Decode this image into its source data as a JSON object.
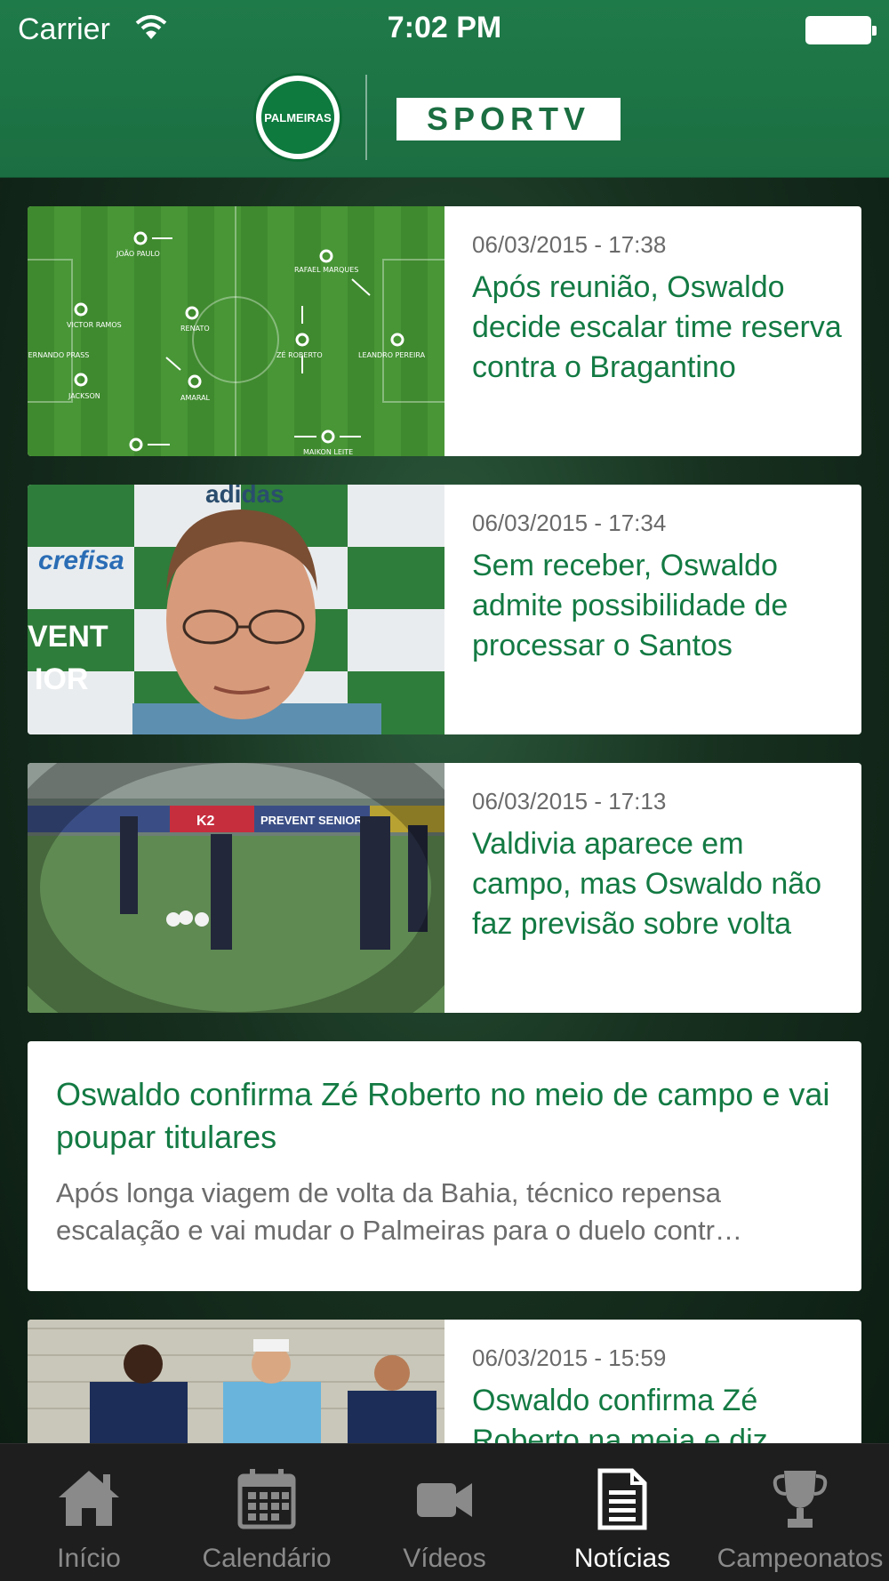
{
  "status_bar": {
    "carrier": "Carrier",
    "time": "7:02 PM"
  },
  "header": {
    "club_logo_text": "PALMEIRAS",
    "partner_logo_text": "SPORTV"
  },
  "news": [
    {
      "date": "06/03/2015 - 17:38",
      "title": "Após reunião, Oswaldo decide escalar time reserva contra o Bragantino",
      "formation_labels": [
        "JOÃO PAULO",
        "RAFAEL MARQUES",
        "VICTOR RAMOS",
        "RENATO",
        "ZÉ ROBERTO",
        "LEANDRO PEREIRA",
        "FERNANDO PRASS",
        "JACKSON",
        "AMARAL",
        "MAIKON LEITE"
      ]
    },
    {
      "date": "06/03/2015 - 17:34",
      "title": "Sem receber, Oswaldo admite possibilidade de processar o Santos",
      "backdrop_texts": [
        "adidas",
        "crefisa",
        "VENT",
        "IOR"
      ]
    },
    {
      "date": "06/03/2015 - 17:13",
      "title": "Valdivia aparece em campo, mas Oswaldo não faz previsão sobre volta",
      "banner_texts": [
        "K2",
        "PREVENT SENIOR"
      ]
    },
    {
      "title": "Oswaldo confirma Zé Roberto no meio de campo e vai poupar titulares",
      "summary": "Após longa viagem de volta da Bahia, técnico repensa escalação e vai mudar o Palmeiras para o duelo contr…"
    },
    {
      "date": "06/03/2015 - 15:59",
      "title": "Oswaldo confirma Zé Roberto na meia e diz"
    }
  ],
  "tabs": [
    {
      "label": "Início",
      "icon": "home-icon"
    },
    {
      "label": "Calendário",
      "icon": "calendar-icon"
    },
    {
      "label": "Vídeos",
      "icon": "video-camera-icon"
    },
    {
      "label": "Notícias",
      "icon": "news-document-icon"
    },
    {
      "label": "Campeonatos",
      "icon": "trophy-icon"
    }
  ],
  "active_tab": "Notícias",
  "colors": {
    "brand_green": "#1b6e41",
    "headline_green": "#137a43",
    "tabbar_bg": "#1e1e1e"
  }
}
